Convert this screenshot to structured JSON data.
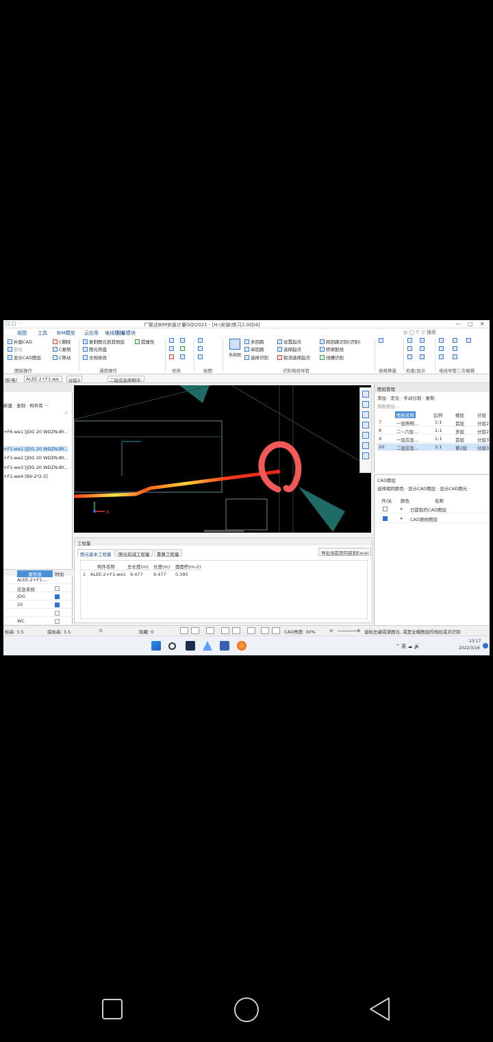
{
  "window": {
    "title": "广联达BIM安装计量GQI2021 - [H:\\安装\\练习2.GQI4]",
    "quick_access": "□ □ · ·",
    "controls": [
      "—",
      "□",
      "✕"
    ]
  },
  "menu": {
    "items": [
      "视图",
      "工具",
      "BIM模型",
      "云应用",
      "电线模块",
      "对量模块"
    ],
    "right": "◎ ◯ ?· ▽ 搜索"
  },
  "ribbon": {
    "cad": [
      "补画CAD",
      "删除",
      "复制",
      "移动",
      "显示CAD图层"
    ],
    "cad_ops": [
      "C删除",
      "C复制",
      "C移动"
    ],
    "copy_group": [
      "复制图元到其他层",
      "图元存盘",
      "文档修改",
      "提属性"
    ],
    "group_labels": [
      "图纸操作",
      "通用操作",
      "修改",
      "绘图",
      "识别电线导管",
      "表格算量",
      "检查/显示",
      "电线导管二次编辑"
    ],
    "system_btn": "系统图",
    "identify": [
      "多回路",
      "单回路",
      "选择识别",
      "设置起点",
      "选择起点",
      "取消选择起点",
      "跨回路识别(识别)",
      "桥架配线",
      "线槽识别"
    ],
    "bridge": "桥架配线"
  },
  "floorbar": {
    "items": [
      "线(电)",
      "ALEE-2+F1-we·",
      "分层3",
      "二层应急照明平·"
    ]
  },
  "left_panel": {
    "tools": "新建 · 复制 · 构件库 ···",
    "components": [
      "+F6-we1 [JDG 20 WDZN-BY...",
      "+F1-we1 [JDG 20 WDZN-BY...",
      "+F1-we2 [JDG 20 WDZN-BY...",
      "+F1-we3 [JDG 20 WDZN-BY...",
      "+F1-we4 [BV-2*2.5]"
    ],
    "prop_header": {
      "name": "属性值",
      "extra": "附加"
    },
    "props": [
      {
        "value": "ALEE-2+F1-...",
        "checked": null
      },
      {
        "value": "应急系统",
        "checked": false
      },
      {
        "value": "JDG",
        "checked": true
      },
      {
        "value": "20",
        "checked": true
      },
      {
        "value": "",
        "checked": false
      },
      {
        "value": "WC",
        "checked": false
      },
      {
        "value": "WDZN-BYJF...",
        "checked": true
      },
      {
        "value": "层顶标高",
        "checked": false
      },
      {
        "value": "层顶标高",
        "checked": false
      },
      {
        "value": "0",
        "checked": false
      },
      {
        "value": "电线导管(电)",
        "checked": false
      }
    ]
  },
  "project_panel": {
    "title": "工程量",
    "tabs": [
      "图元基本工程量",
      "图元扣减工程量",
      "重算工程量"
    ],
    "export": "导出当前页内容到Excel",
    "columns": [
      "构件名称",
      "总长度(m)",
      "长度(m)",
      "面面积(m-2)"
    ],
    "rows": [
      {
        "idx": "1",
        "name": "ALEE-2+F1-we1",
        "total": "9.477",
        "len": "9.477",
        "area": "0.395"
      }
    ]
  },
  "drawing_mgr": {
    "title": "图纸管理",
    "tools": "添加 · 定位 · 手动分割 · 复制",
    "search": "搜索图纸...",
    "columns": [
      "图纸名称",
      "比例",
      "楼层",
      "分层"
    ],
    "rows": [
      {
        "idx": "7",
        "name": "一层照明...",
        "ratio": "1:1",
        "floor": "首层",
        "layer": "分层2",
        "sel": false
      },
      {
        "idx": "8",
        "name": "二~六层...",
        "ratio": "1:1",
        "floor": "多层",
        "layer": "分层2",
        "sel": false
      },
      {
        "idx": "9",
        "name": "一层应急...",
        "ratio": "1:1",
        "floor": "首层",
        "layer": "分层3",
        "sel": false
      },
      {
        "idx": "10",
        "name": "二层应急...",
        "ratio": "1:1",
        "floor": "第2层",
        "layer": "分层3",
        "sel": true
      }
    ]
  },
  "cad_layer": {
    "title": "CAD图层",
    "tools": "选择相同颜色 · 显示CAD图层 · 显示CAD图元 ·",
    "columns": [
      "开/关",
      "颜色",
      "名称"
    ],
    "rows": [
      {
        "name": "已提取的CAD图层",
        "on": false
      },
      {
        "name": "CAD原始图层",
        "on": true
      }
    ]
  },
  "statusbar": {
    "items": [
      "标高: 3.5",
      "底标高: 3.5",
      "0",
      "隐藏: 0",
      "CAD亮度: 30%",
      "鼠标左键或滚图元, 或是全模图层的线段或点识别"
    ]
  },
  "taskbar": {
    "tray": "^ 英 ☁ 🔊",
    "time": "23:17",
    "date": "2022/3/16"
  },
  "colors": {
    "accent": "#1d4f91",
    "highlight": "#4c8fd9",
    "red_mark": "#f25a5a",
    "teal": "#1f6b66"
  }
}
